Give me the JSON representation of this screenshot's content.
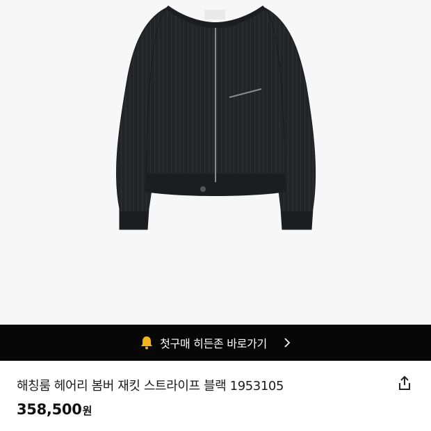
{
  "product": {
    "image_alt": "black striped bomber jacket photo",
    "title": "해칭룸 헤어리 봄버 재킷 스트라이프 블랙 1953105",
    "price_number": "358,500",
    "price_unit": "원"
  },
  "promo": {
    "label": "첫구매 히든존 바로가기",
    "icon": "bell-icon",
    "chevron_icon": "chevron-right-icon",
    "bg_color": "#070707",
    "bell_color": "#f2b21b"
  },
  "actions": {
    "share_icon": "share-icon"
  }
}
